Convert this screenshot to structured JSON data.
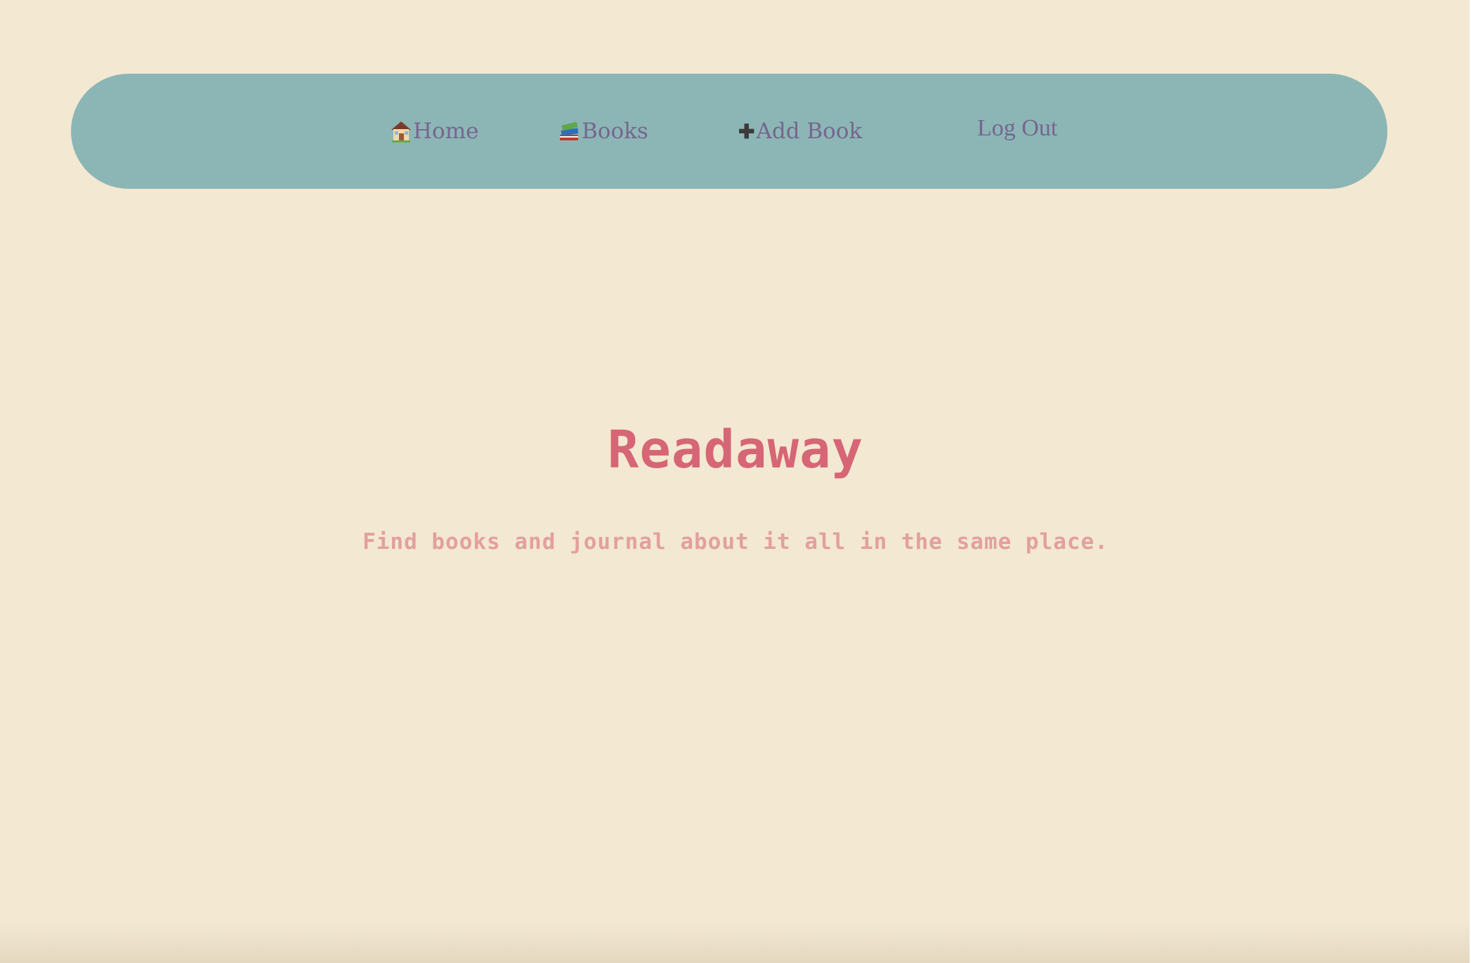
{
  "nav": {
    "items": [
      {
        "icon": "house-icon",
        "label": "Home"
      },
      {
        "icon": "books-icon",
        "label": "Books"
      },
      {
        "icon": "plus-icon",
        "label": "Add Book",
        "icon_glyph": "✚"
      },
      {
        "label": "Log Out"
      }
    ]
  },
  "hero": {
    "title": "Readaway",
    "subtitle": "Find books and journal about it all in the same place."
  },
  "colors": {
    "background": "#f3e8d2",
    "navbar": "#8cb6b5",
    "nav_text": "#75668f",
    "title": "#d66675",
    "subtitle": "#e2a09e"
  }
}
